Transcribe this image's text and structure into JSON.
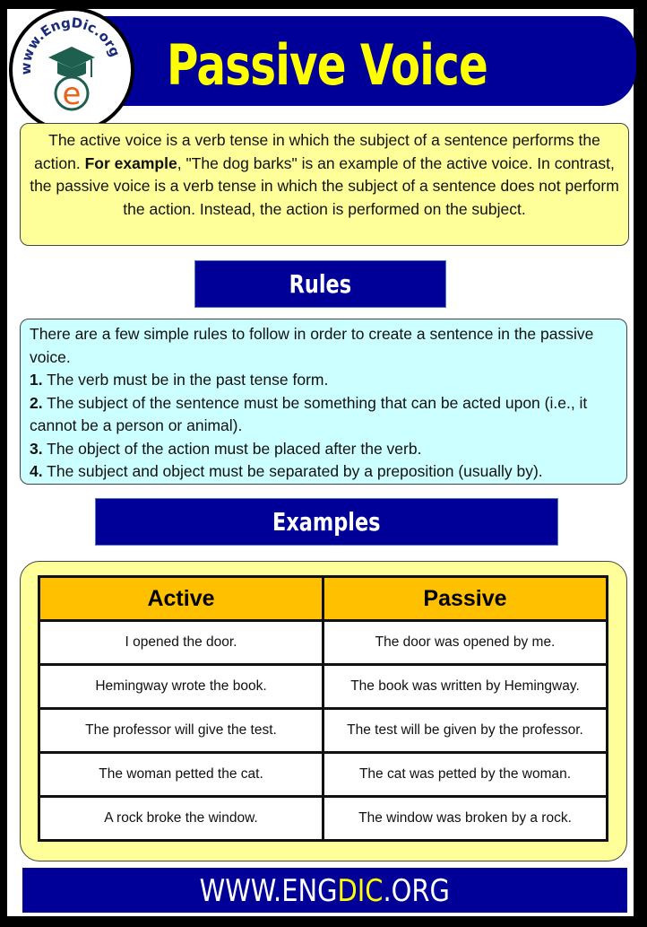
{
  "header": {
    "title": "Passive Voice",
    "logo_text": "www.EngDic.org"
  },
  "intro": {
    "text_before": "The active voice is a verb tense in which the subject of a sentence performs the action. ",
    "bold": "For example",
    "text_after": ", \"The dog barks\" is an example of the active voice. In contrast, the passive voice is a verb tense in which the subject of a sentence does not perform the action. Instead, the action is performed on the subject."
  },
  "rules": {
    "heading": "Rules",
    "intro": "There are a few simple rules to follow in order to create a sentence in the passive voice.",
    "items": [
      {
        "num": "1.",
        "text": " The verb must be in the past tense form."
      },
      {
        "num": "2.",
        "text": " The subject of the sentence must be something that can be acted upon (i.e., it cannot be a person or animal)."
      },
      {
        "num": "3.",
        "text": " The object of the action must be placed after the verb."
      },
      {
        "num": "4.",
        "text": " The subject and object must be separated by a preposition (usually by)."
      }
    ]
  },
  "examples": {
    "heading": "Examples",
    "columns": [
      "Active",
      "Passive"
    ],
    "rows": [
      [
        "I opened the door.",
        "The door was opened by me."
      ],
      [
        "Hemingway wrote the book.",
        "The book was written by Hemingway."
      ],
      [
        "The professor will give the test.",
        "The test will be given by the professor."
      ],
      [
        "The woman petted the cat.",
        "The cat was petted by the woman."
      ],
      [
        "A rock broke the window.",
        "The window was broken by a rock."
      ]
    ]
  },
  "footer": {
    "prefix": "WWW.ENG",
    "highlight": "DIC",
    "suffix": ".ORG"
  },
  "colors": {
    "navy": "#000099",
    "yellow": "#ffff00",
    "light_yellow": "#ffff99",
    "light_cyan": "#ccffff",
    "table_header": "#ffc000"
  }
}
